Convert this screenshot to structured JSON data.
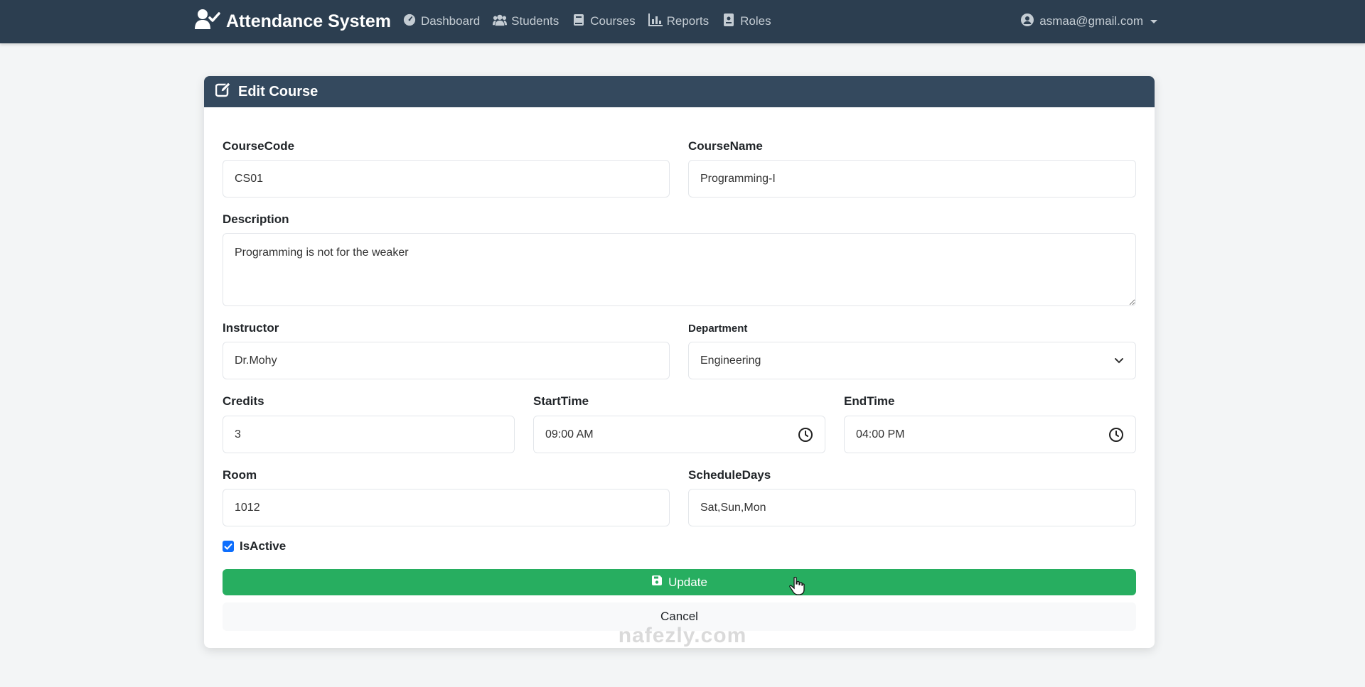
{
  "navbar": {
    "brand": "Attendance System",
    "links": [
      {
        "label": "Dashboard",
        "icon": "dashboard-icon"
      },
      {
        "label": "Students",
        "icon": "users-icon"
      },
      {
        "label": "Courses",
        "icon": "book-icon"
      },
      {
        "label": "Reports",
        "icon": "chart-icon"
      },
      {
        "label": "Roles",
        "icon": "badge-icon"
      }
    ],
    "user_email": "asmaa@gmail.com"
  },
  "card": {
    "title": "Edit Course"
  },
  "form": {
    "course_code": {
      "label": "CourseCode",
      "value": "CS01"
    },
    "course_name": {
      "label": "CourseName",
      "value": "Programming-I"
    },
    "description": {
      "label": "Description",
      "value": "Programming is not for the weaker"
    },
    "instructor": {
      "label": "Instructor",
      "value": "Dr.Mohy"
    },
    "department": {
      "label": "Department",
      "value": "Engineering"
    },
    "credits": {
      "label": "Credits",
      "value": "3"
    },
    "start_time": {
      "label": "StartTime",
      "value": "09:00 AM"
    },
    "end_time": {
      "label": "EndTime",
      "value": "04:00 PM"
    },
    "room": {
      "label": "Room",
      "value": "1012"
    },
    "schedule_days": {
      "label": "ScheduleDays",
      "value": "Sat,Sun,Mon"
    },
    "is_active": {
      "label": "IsActive",
      "checked": true
    }
  },
  "buttons": {
    "update": "Update",
    "cancel": "Cancel"
  },
  "watermark": "nafezly.com",
  "colors": {
    "navbar": "#2c3e50",
    "card_header": "#34495e",
    "update_button": "#27ae60",
    "checkbox": "#0d6efd"
  }
}
